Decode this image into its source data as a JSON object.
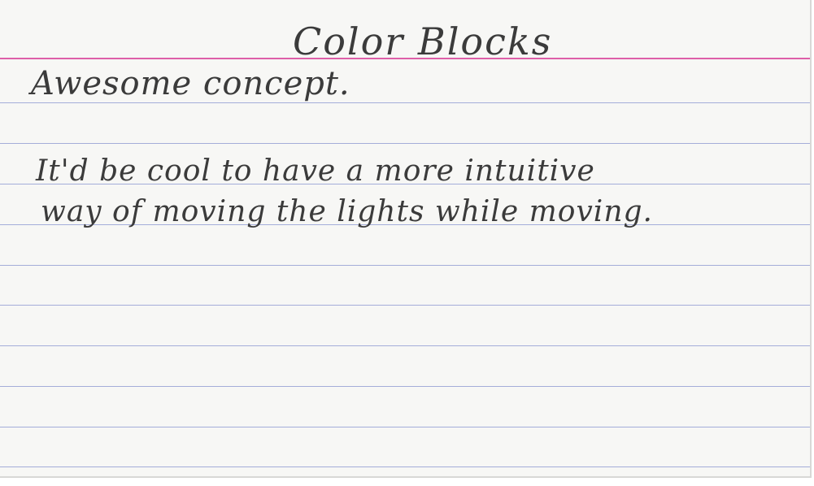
{
  "card": {
    "title": "Color Blocks",
    "lines": [
      "Awesome concept.",
      "It'd be cool to have a more intuitive",
      "way of moving the lights while moving."
    ]
  },
  "colors": {
    "paper": "#f7f7f5",
    "margin_line": "#d9449a",
    "rule_lines": "#9aa4d6",
    "pencil": "#3b3b3b"
  }
}
